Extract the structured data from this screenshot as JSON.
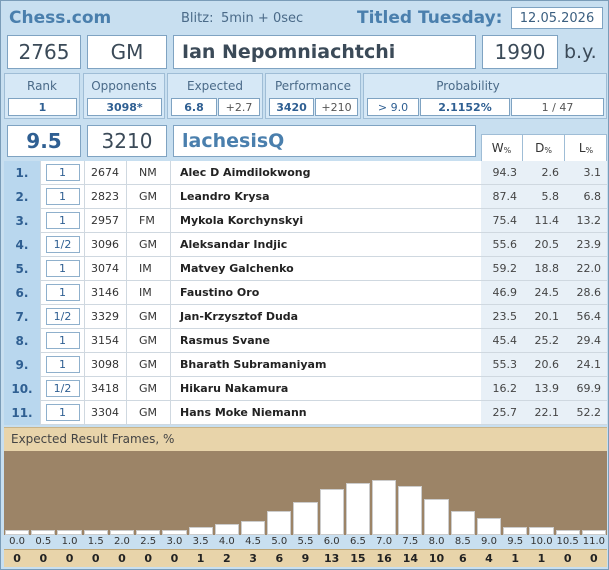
{
  "header": {
    "brand": "Chess.com",
    "event_type": "Blitz:",
    "time_control": "5min + 0sec",
    "tournament": "Titled Tuesday:",
    "date": "12.05.2026"
  },
  "player": {
    "rating": "2765",
    "title": "GM",
    "name": "Ian Nepomniachtchi",
    "birth_year": "1990",
    "birth_suffix": "b.y."
  },
  "stats": {
    "rank_label": "Rank",
    "rank": "1",
    "opponents_label": "Opponents",
    "opponents": "3098*",
    "expected_label": "Expected",
    "expected": "6.8",
    "expected_diff": "+2.7",
    "performance_label": "Performance",
    "performance": "3420",
    "performance_diff": "+210",
    "probability_label": "Probability",
    "prob_threshold": "> 9.0",
    "prob_value": "2.1152%",
    "prob_ratio": "1 / 47"
  },
  "summary": {
    "score": "9.5",
    "tpr": "3210",
    "username": "lachesisQ",
    "col_w": "W",
    "col_d": "D",
    "col_l": "L",
    "pct": "%"
  },
  "games": [
    {
      "n": "1.",
      "res": "1",
      "elo": "2674",
      "title": "NM",
      "name": "Alec D Aimdilokwong",
      "w": "94.3",
      "d": "2.6",
      "l": "3.1"
    },
    {
      "n": "2.",
      "res": "1",
      "elo": "2823",
      "title": "GM",
      "name": "Leandro Krysa",
      "w": "87.4",
      "d": "5.8",
      "l": "6.8"
    },
    {
      "n": "3.",
      "res": "1",
      "elo": "2957",
      "title": "FM",
      "name": "Mykola Korchynskyi",
      "w": "75.4",
      "d": "11.4",
      "l": "13.2"
    },
    {
      "n": "4.",
      "res": "1/2",
      "elo": "3096",
      "title": "GM",
      "name": "Aleksandar Indjic",
      "w": "55.6",
      "d": "20.5",
      "l": "23.9"
    },
    {
      "n": "5.",
      "res": "1",
      "elo": "3074",
      "title": "IM",
      "name": "Matvey Galchenko",
      "w": "59.2",
      "d": "18.8",
      "l": "22.0"
    },
    {
      "n": "6.",
      "res": "1",
      "elo": "3146",
      "title": "IM",
      "name": "Faustino Oro",
      "w": "46.9",
      "d": "24.5",
      "l": "28.6"
    },
    {
      "n": "7.",
      "res": "1/2",
      "elo": "3329",
      "title": "GM",
      "name": "Jan-Krzysztof Duda",
      "w": "23.5",
      "d": "20.1",
      "l": "56.4"
    },
    {
      "n": "8.",
      "res": "1",
      "elo": "3154",
      "title": "GM",
      "name": "Rasmus Svane",
      "w": "45.4",
      "d": "25.2",
      "l": "29.4"
    },
    {
      "n": "9.",
      "res": "1",
      "elo": "3098",
      "title": "GM",
      "name": "Bharath Subramaniyam",
      "w": "55.3",
      "d": "20.6",
      "l": "24.1"
    },
    {
      "n": "10.",
      "res": "1/2",
      "elo": "3418",
      "title": "GM",
      "name": "Hikaru Nakamura",
      "w": "16.2",
      "d": "13.9",
      "l": "69.9"
    },
    {
      "n": "11.",
      "res": "1",
      "elo": "3304",
      "title": "GM",
      "name": "Hans Moke Niemann",
      "w": "25.7",
      "d": "22.1",
      "l": "52.2"
    }
  ],
  "chart_title": "Expected Result Frames, %",
  "chart_data": {
    "type": "bar",
    "title": "Expected Result Frames, %",
    "categories": [
      "0.0",
      "0.5",
      "1.0",
      "1.5",
      "2.0",
      "2.5",
      "3.0",
      "3.5",
      "4.0",
      "4.5",
      "5.0",
      "5.5",
      "6.0",
      "6.5",
      "7.0",
      "7.5",
      "8.0",
      "8.5",
      "9.0",
      "9.5",
      "10.0",
      "10.5",
      "11.0"
    ],
    "values": [
      0,
      0,
      0,
      0,
      0,
      0,
      0,
      1,
      2,
      3,
      6,
      9,
      13,
      15,
      16,
      14,
      10,
      6,
      4,
      1,
      1,
      0,
      0
    ]
  },
  "colors": {
    "accent": "#4a7fad",
    "panel": "#c8dff0",
    "chart_bg": "#9c8467",
    "chart_band": "#e8d4aa"
  }
}
